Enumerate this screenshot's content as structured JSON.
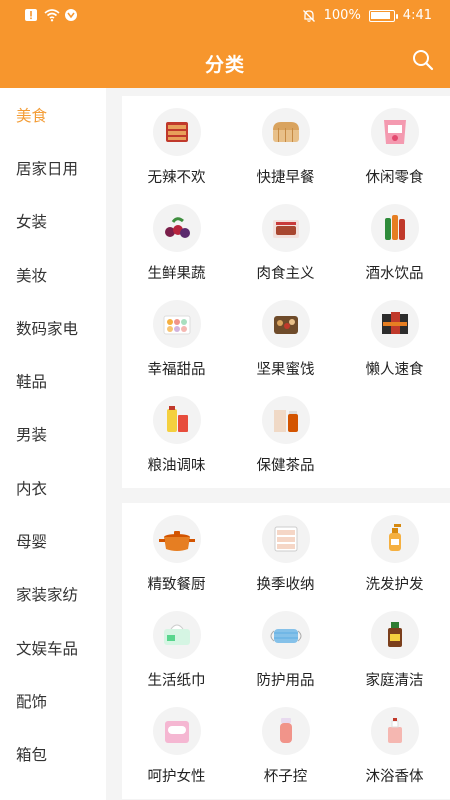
{
  "status_bar": {
    "battery": "100%",
    "time": "4:41"
  },
  "header": {
    "title": "分类"
  },
  "sidebar": {
    "items": [
      {
        "label": "美食",
        "active": true
      },
      {
        "label": "居家日用"
      },
      {
        "label": "女装"
      },
      {
        "label": "美妆"
      },
      {
        "label": "数码家电"
      },
      {
        "label": "鞋品"
      },
      {
        "label": "男装"
      },
      {
        "label": "内衣"
      },
      {
        "label": "母婴"
      },
      {
        "label": "家装家纺"
      },
      {
        "label": "文娱车品"
      },
      {
        "label": "配饰"
      },
      {
        "label": "箱包"
      }
    ]
  },
  "sections": [
    {
      "items": [
        {
          "label": "无辣不欢",
          "icon": "spicy-snack-icon"
        },
        {
          "label": "快捷早餐",
          "icon": "bread-icon"
        },
        {
          "label": "休闲零食",
          "icon": "snack-bag-icon"
        },
        {
          "label": "生鲜果蔬",
          "icon": "berries-icon"
        },
        {
          "label": "肉食主义",
          "icon": "meat-box-icon"
        },
        {
          "label": "酒水饮品",
          "icon": "bottles-icon"
        },
        {
          "label": "幸福甜品",
          "icon": "macaron-icon"
        },
        {
          "label": "坚果蜜饯",
          "icon": "nuts-icon"
        },
        {
          "label": "懒人速食",
          "icon": "noodle-packs-icon"
        },
        {
          "label": "粮油调味",
          "icon": "oil-rice-icon"
        },
        {
          "label": "保健茶品",
          "icon": "tea-icon"
        }
      ]
    },
    {
      "items": [
        {
          "label": "精致餐厨",
          "icon": "pot-icon"
        },
        {
          "label": "换季收纳",
          "icon": "drawer-icon"
        },
        {
          "label": "洗发护发",
          "icon": "shampoo-icon"
        },
        {
          "label": "生活纸巾",
          "icon": "tissue-icon"
        },
        {
          "label": "防护用品",
          "icon": "mask-icon"
        },
        {
          "label": "家庭清洁",
          "icon": "disinfectant-icon"
        },
        {
          "label": "呵护女性",
          "icon": "pad-icon"
        },
        {
          "label": "杯子控",
          "icon": "cup-icon"
        },
        {
          "label": "沐浴香体",
          "icon": "perfume-icon"
        }
      ]
    }
  ]
}
